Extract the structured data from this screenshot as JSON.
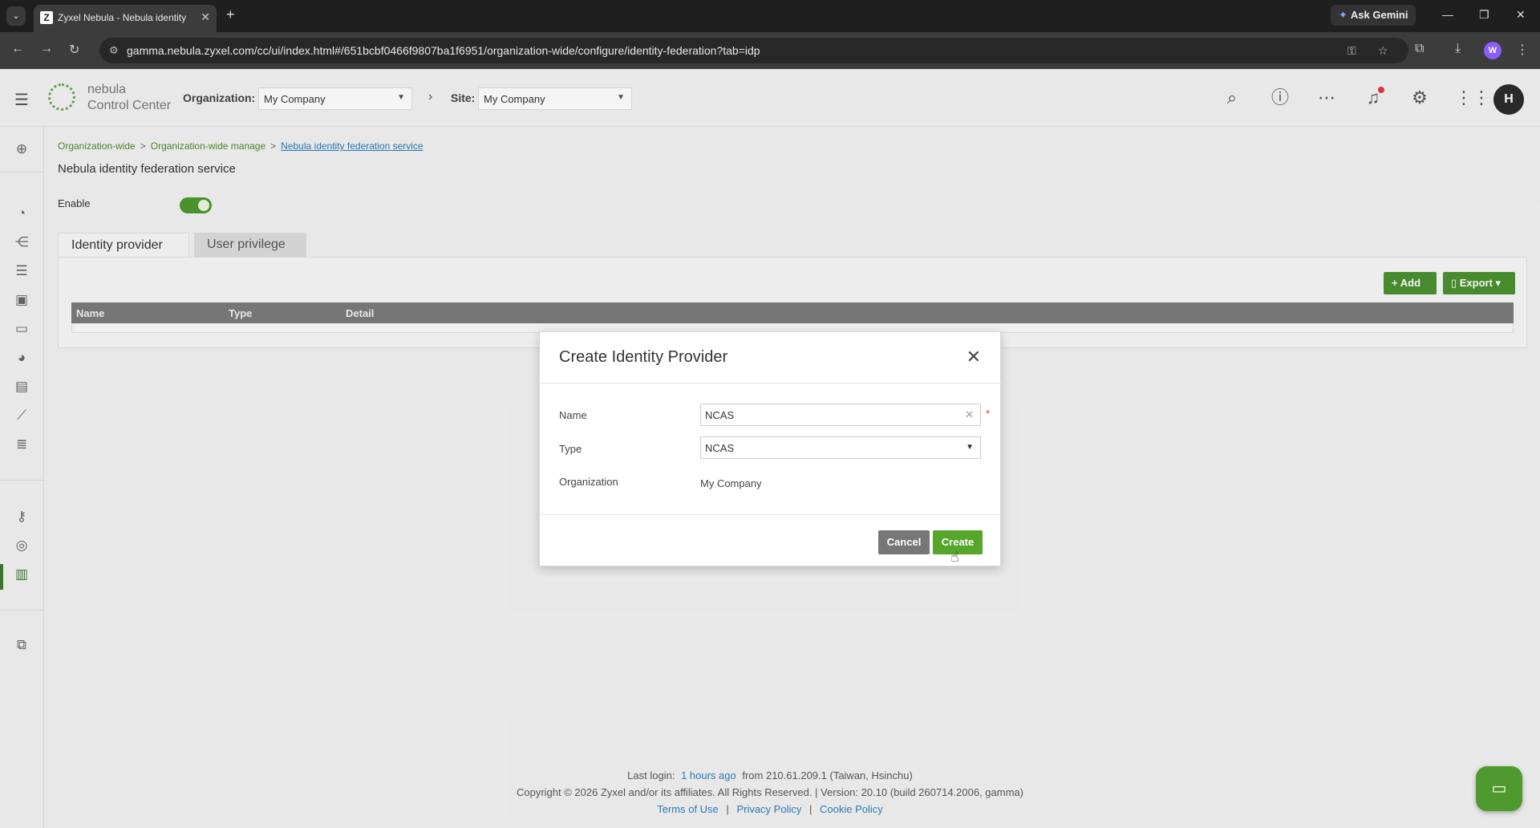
{
  "browser": {
    "tab_title": "Zyxel Nebula - Nebula identity",
    "favicon_letter": "Z",
    "url": "gamma.nebula.zyxel.com/cc/ui/index.html#/651bcbf0466f9807ba1f6951/organization-wide/configure/identity-federation?tab=idp",
    "gemini_label": "Ask Gemini",
    "profile_initial": "W"
  },
  "header": {
    "logo_line1": "nebula",
    "logo_line2": "Control Center",
    "org_label": "Organization:",
    "org_value": "My Company",
    "site_label": "Site:",
    "site_value": "My Company",
    "avatar_initial": "H"
  },
  "breadcrumb": {
    "item1": "Organization-wide",
    "item2": "Organization-wide manage",
    "item3": "Nebula identity federation service"
  },
  "page": {
    "title": "Nebula identity federation service",
    "enable_label": "Enable",
    "enabled": true
  },
  "tabs": [
    {
      "label": "Identity provider",
      "active": true
    },
    {
      "label": "User privilege",
      "active": false
    }
  ],
  "toolbar": {
    "add_label": "Add",
    "export_label": "Export"
  },
  "table": {
    "columns": [
      "Name",
      "Type",
      "Detail"
    ]
  },
  "modal": {
    "title": "Create Identity Provider",
    "name_label": "Name",
    "name_value": "NCAS",
    "type_label": "Type",
    "type_value": "NCAS",
    "org_label": "Organization",
    "org_value": "My Company",
    "cancel_label": "Cancel",
    "create_label": "Create"
  },
  "footer": {
    "last_login_prefix": "Last login:",
    "last_login_time": "1 hours ago",
    "last_login_from": "from 210.61.209.1 (Taiwan, Hsinchu)",
    "copyright": "Copyright © 2026 Zyxel and/or its affiliates. All Rights Reserved. | Version: 20.10 (build 260714.2006, gamma)",
    "terms": "Terms of Use",
    "privacy": "Privacy Policy",
    "cookie": "Cookie Policy",
    "divider": "|"
  },
  "colors": {
    "accent_green": "#4a9130",
    "link_blue": "#2a7ab8",
    "cancel_gray": "#777777",
    "create_green": "#55a62a"
  }
}
